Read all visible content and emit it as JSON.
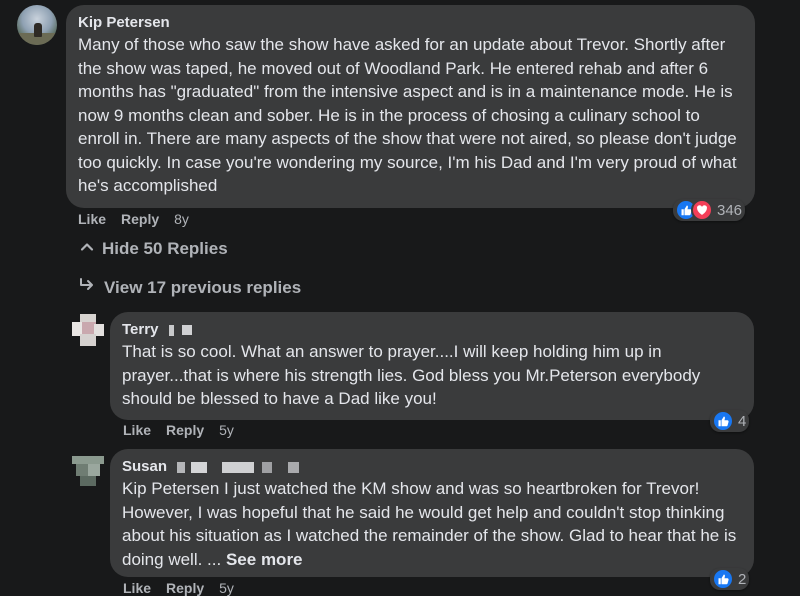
{
  "comments": [
    {
      "author": "Kip Petersen",
      "text": "Many of those who saw the show have asked for an update about Trevor. Shortly after the show was taped, he moved out of Woodland Park. He entered rehab and after 6 months has \"graduated\" from the intensive aspect and is in a maintenance mode. He is now 9 months clean and sober. He is in the process of chosing a culinary school to enroll in. There are many aspects of the show that were not aired, so please don't judge too quickly. In case you're wondering my source, I'm his Dad and I'm very proud of what he's accomplished",
      "like_label": "Like",
      "reply_label": "Reply",
      "time": "8y",
      "reaction_count": "346",
      "reactions": [
        "like",
        "love"
      ]
    }
  ],
  "thread": {
    "hide_replies_label": "Hide 50 Replies",
    "view_previous_label": "View 17 previous replies"
  },
  "replies": [
    {
      "author": "Terry",
      "text": "That is so cool. What an answer to prayer....I will keep holding him up in prayer...that is where his strength lies. God bless you Mr.Peterson everybody should be blessed to have a Dad like you!",
      "like_label": "Like",
      "reply_label": "Reply",
      "time": "5y",
      "reaction_count": "4"
    },
    {
      "author": "Susan",
      "text": "Kip Petersen I just watched the KM show and was so heartbroken for Trevor! However, I was hopeful that he said he would get help and couldn't stop thinking about his situation as I watched the remainder of the show. Glad to hear that he is doing well. ...",
      "see_more_label": "See more",
      "like_label": "Like",
      "reply_label": "Reply",
      "time": "5y",
      "reaction_count": "2"
    }
  ],
  "colors": {
    "background": "#18191a",
    "bubble": "#3a3b3c",
    "text": "#e4e6eb",
    "secondary_text": "#b0b3b8",
    "like_blue": "#1877f2",
    "love_red": "#f33e58"
  },
  "icons": [
    "thumbs-up-icon",
    "heart-icon",
    "chevron-up-icon",
    "reply-arrow-icon"
  ]
}
